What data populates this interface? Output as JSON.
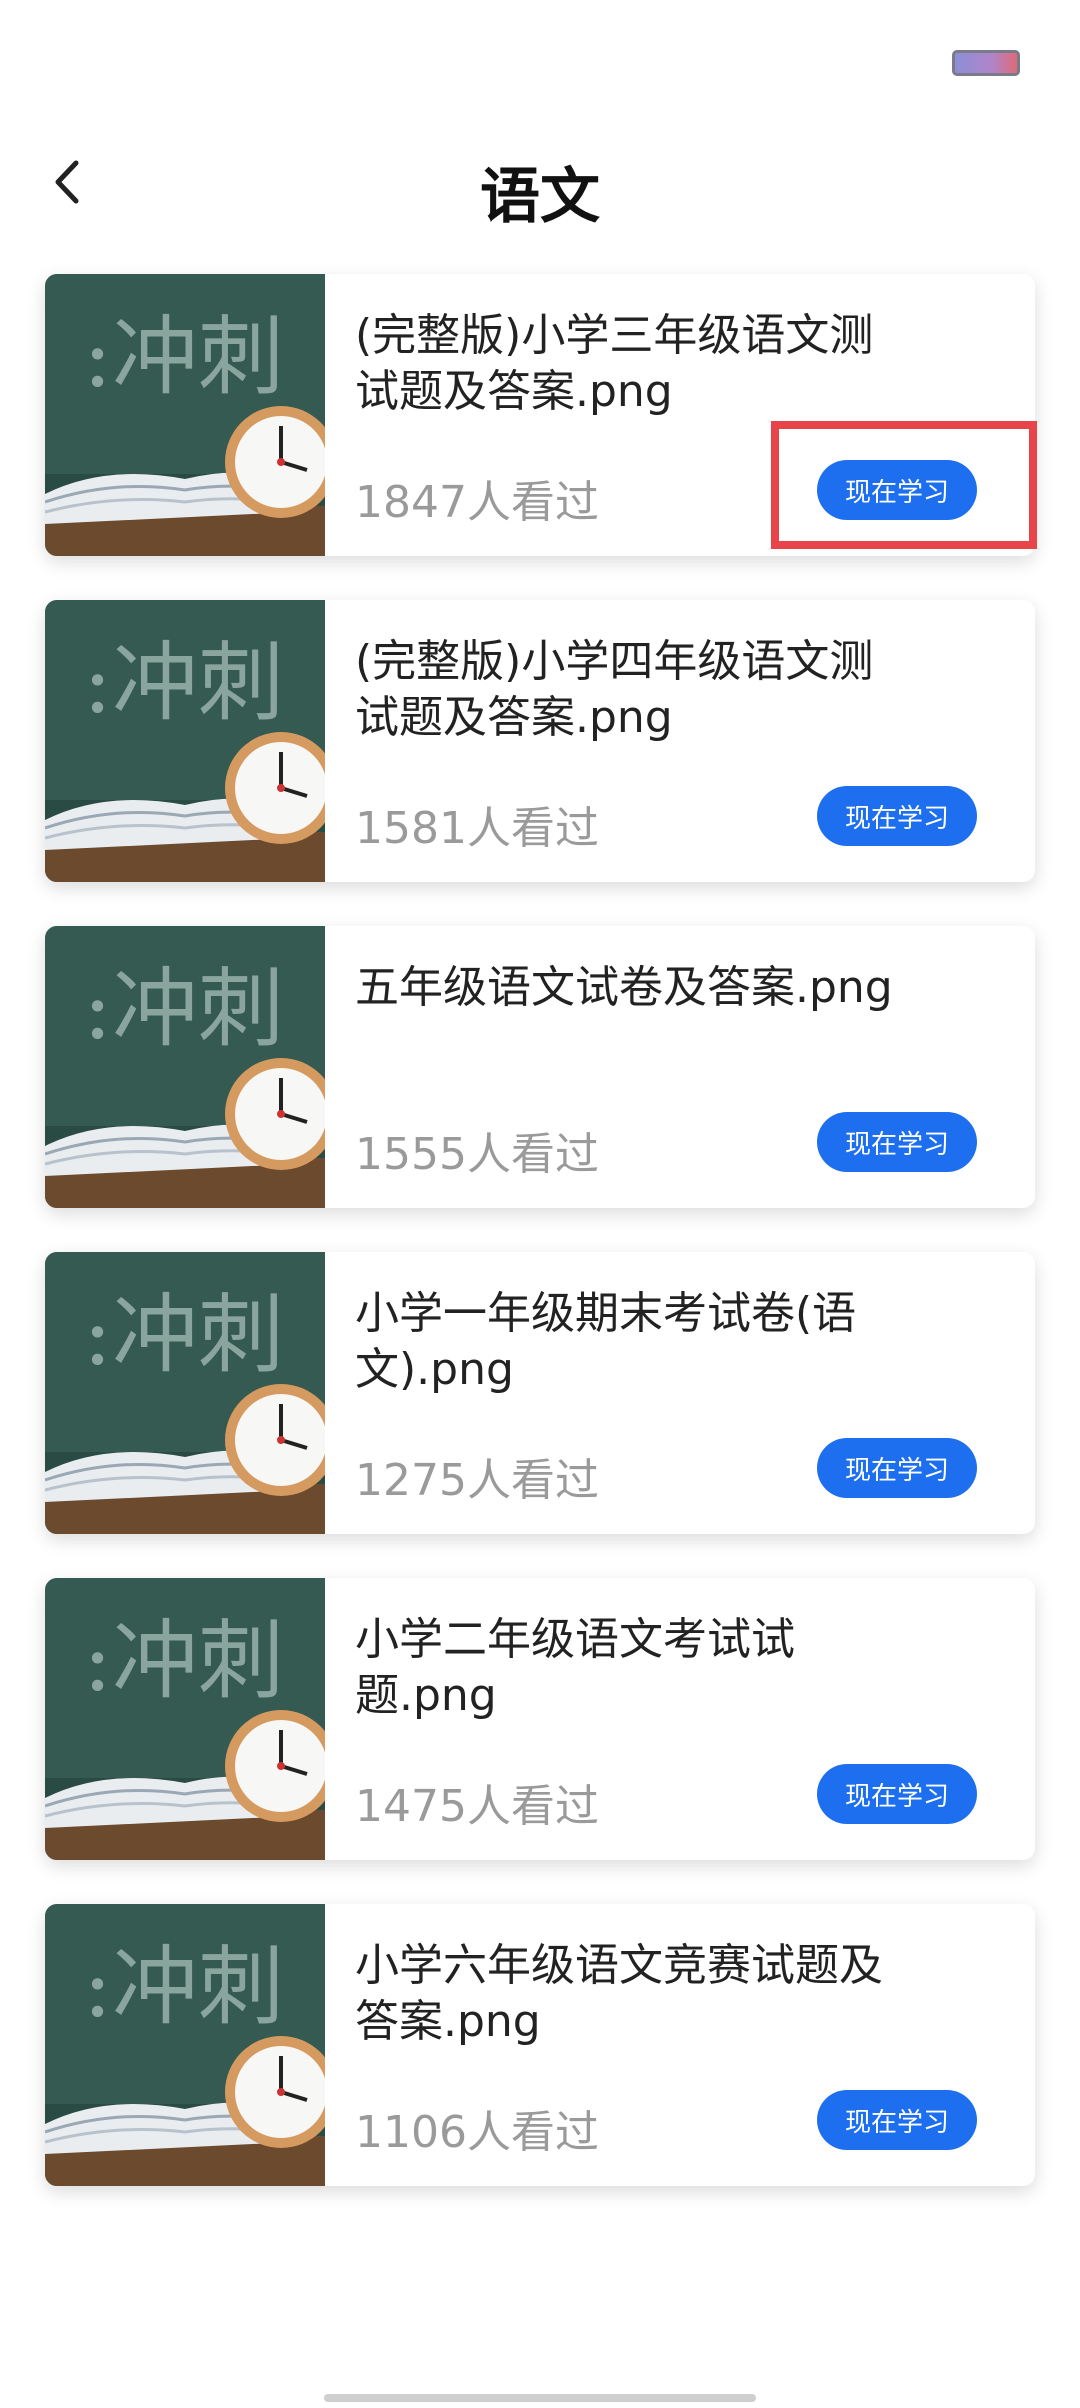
{
  "header": {
    "title": "语文"
  },
  "items": [
    {
      "title": "(完整版)小学三年级语文测试题及答案.png",
      "views": "1847人看过",
      "button": "现在学习"
    },
    {
      "title": "(完整版)小学四年级语文测试题及答案.png",
      "views": "1581人看过",
      "button": "现在学习"
    },
    {
      "title": "五年级语文试卷及答案.png",
      "views": "1555人看过",
      "button": "现在学习"
    },
    {
      "title": "小学一年级期末考试卷(语文).png",
      "views": "1275人看过",
      "button": "现在学习"
    },
    {
      "title": "小学二年级语文考试试题.png",
      "views": "1475人看过",
      "button": "现在学习"
    },
    {
      "title": "小学六年级语文竞赛试题及答案.png",
      "views": "1106人看过",
      "button": "现在学习"
    }
  ],
  "colors": {
    "accent": "#1d6ff0",
    "highlight": "#e8454a",
    "muted": "#9a9a9a"
  },
  "icons": {
    "back": "chevron-left-icon",
    "battery": "battery-icon"
  }
}
